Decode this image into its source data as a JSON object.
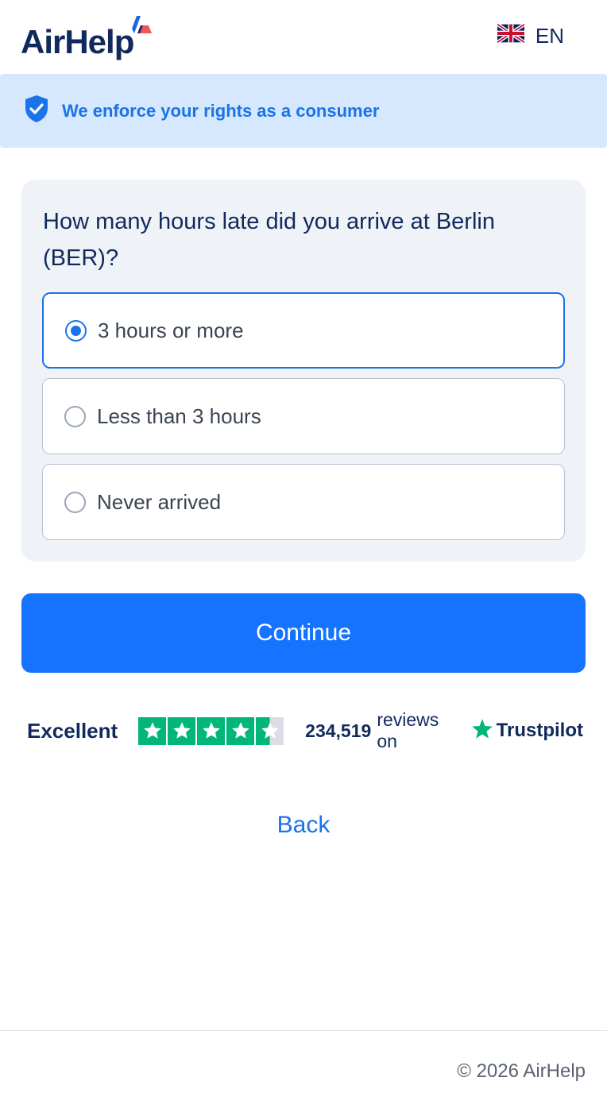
{
  "header": {
    "logo_text": "AirHelp",
    "language": {
      "code": "EN",
      "flag_icon": "uk-flag-icon"
    }
  },
  "banner": {
    "text": "We enforce your rights as a consumer",
    "icon": "shield-check-icon"
  },
  "question": {
    "title": "How many hours late did you arrive at Berlin (BER)?",
    "options": [
      {
        "label": "3 hours or more",
        "selected": true
      },
      {
        "label": "Less than 3 hours",
        "selected": false
      },
      {
        "label": "Never arrived",
        "selected": false
      }
    ]
  },
  "actions": {
    "continue_label": "Continue",
    "back_label": "Back"
  },
  "trustpilot": {
    "rating_label": "Excellent",
    "stars": 4.5,
    "review_count": "234,519",
    "reviews_on_text": "reviews on",
    "brand": "Trustpilot"
  },
  "footer": {
    "copyright": "© 2026 AirHelp"
  },
  "colors": {
    "brand_dark": "#12295c",
    "accent_blue": "#1573ff",
    "banner_bg": "#d6e8fd",
    "trustpilot_green": "#00b67a"
  }
}
